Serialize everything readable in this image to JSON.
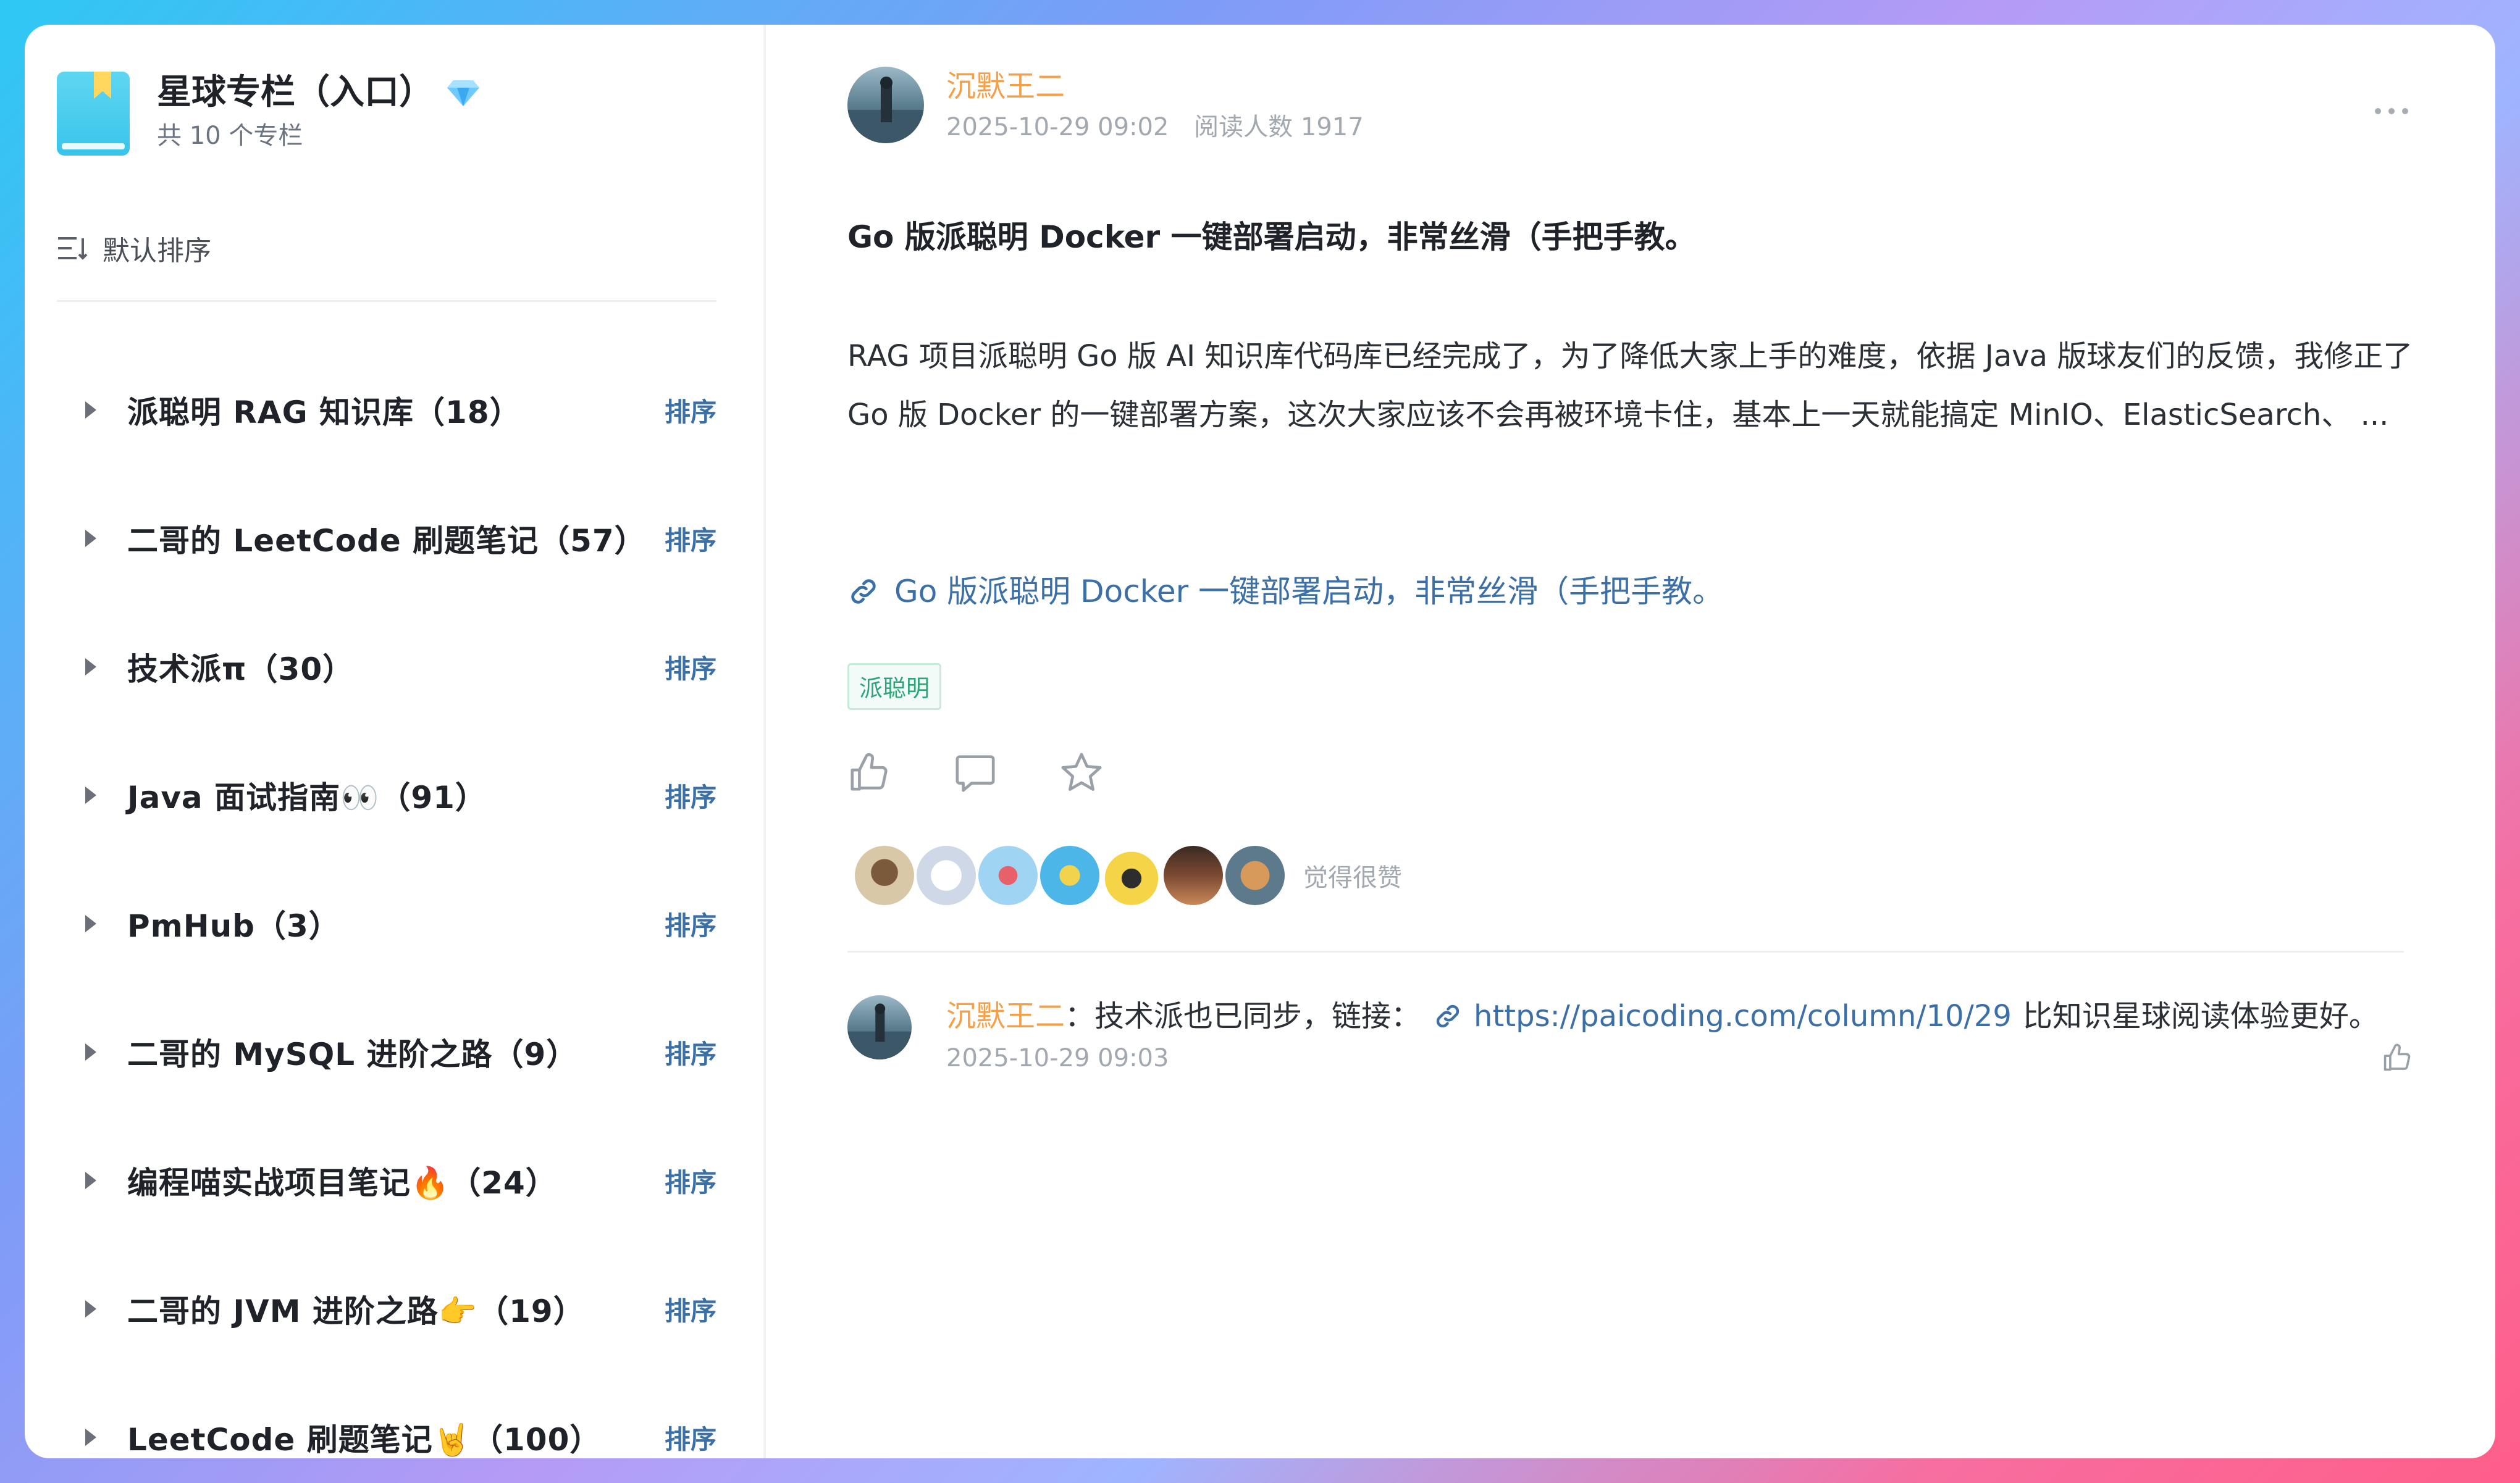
{
  "sidebar": {
    "title": "星球专栏（入口）",
    "subtitle": "共 10 个专栏",
    "sort_label": "默认排序",
    "items": [
      {
        "name": "派聪明 RAG 知识库（18）",
        "action": "排序"
      },
      {
        "name": "二哥的 LeetCode 刷题笔记（57）",
        "action": "排序"
      },
      {
        "name": "技术派π（30）",
        "action": "排序"
      },
      {
        "name": "Java 面试指南👀（91）",
        "action": "排序"
      },
      {
        "name": "PmHub（3）",
        "action": "排序"
      },
      {
        "name": "二哥的 MySQL 进阶之路（9）",
        "action": "排序"
      },
      {
        "name": "编程喵实战项目笔记🔥（24）",
        "action": "排序"
      },
      {
        "name": "二哥的 JVM 进阶之路👉（19）",
        "action": "排序"
      },
      {
        "name": "LeetCode 刷题笔记🤘（100）",
        "action": "排序"
      }
    ]
  },
  "post": {
    "author": "沉默王二",
    "time": "2025-10-29 09:02",
    "reads": "阅读人数 1917",
    "title": "Go 版派聪明 Docker 一键部署启动，非常丝滑（手把手教。",
    "body": "RAG 项目派聪明 Go 版 AI 知识库代码库已经完成了，为了降低大家上手的难度，依据 Java 版球友们的反馈，我修正了 Go 版 Docker 的一键部署方案，这次大家应该不会再被环境卡住，基本上一天就能搞定 MinIO、ElasticSearch、 ...",
    "link_text": "Go 版派聪明 Docker 一键部署启动，非常丝滑（手把手教。",
    "tag": "派聪明",
    "likers_text": "觉得很赞"
  },
  "comment": {
    "author": "沉默王二",
    "separator": "：",
    "text": "技术派也已同步，链接：",
    "link": "https://paicoding.com/column/10/29",
    "tail": "比知识星球阅读体验更好。",
    "time": "2025-10-29 09:03"
  },
  "icons": {
    "book": "book-icon",
    "diamond": "diamond-icon",
    "sort": "sort-icon",
    "more": "more-icon",
    "link": "link-icon",
    "like": "thumbs-up-icon",
    "comment": "comment-icon",
    "favorite": "star-icon"
  },
  "colors": {
    "author": "#f5a048",
    "link": "#3b6fa6",
    "tag": "#2ea57a",
    "meta": "#a2a8b0"
  }
}
